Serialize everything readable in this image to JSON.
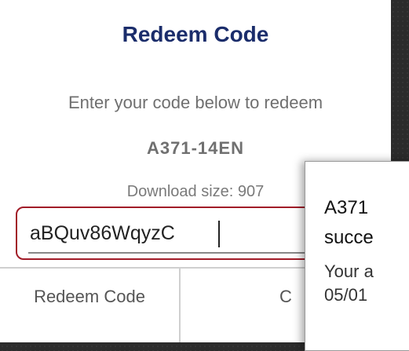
{
  "dialog": {
    "title": "Redeem Code",
    "instruction": "Enter your code below to redeem",
    "code": "A371-14EN",
    "download_size": "Download size: 907",
    "input": {
      "value": "aBQuv86WqyzC",
      "placeholder": ""
    },
    "buttons": {
      "redeem_label": "Redeem Code",
      "cancel_label": "C"
    }
  },
  "popup": {
    "title_line1": "A371",
    "title_line2": "succe",
    "body_line1": "Your a",
    "body_line2": "05/01"
  },
  "colors": {
    "title": "#1b2d6b",
    "highlight_border": "#a11c28"
  }
}
